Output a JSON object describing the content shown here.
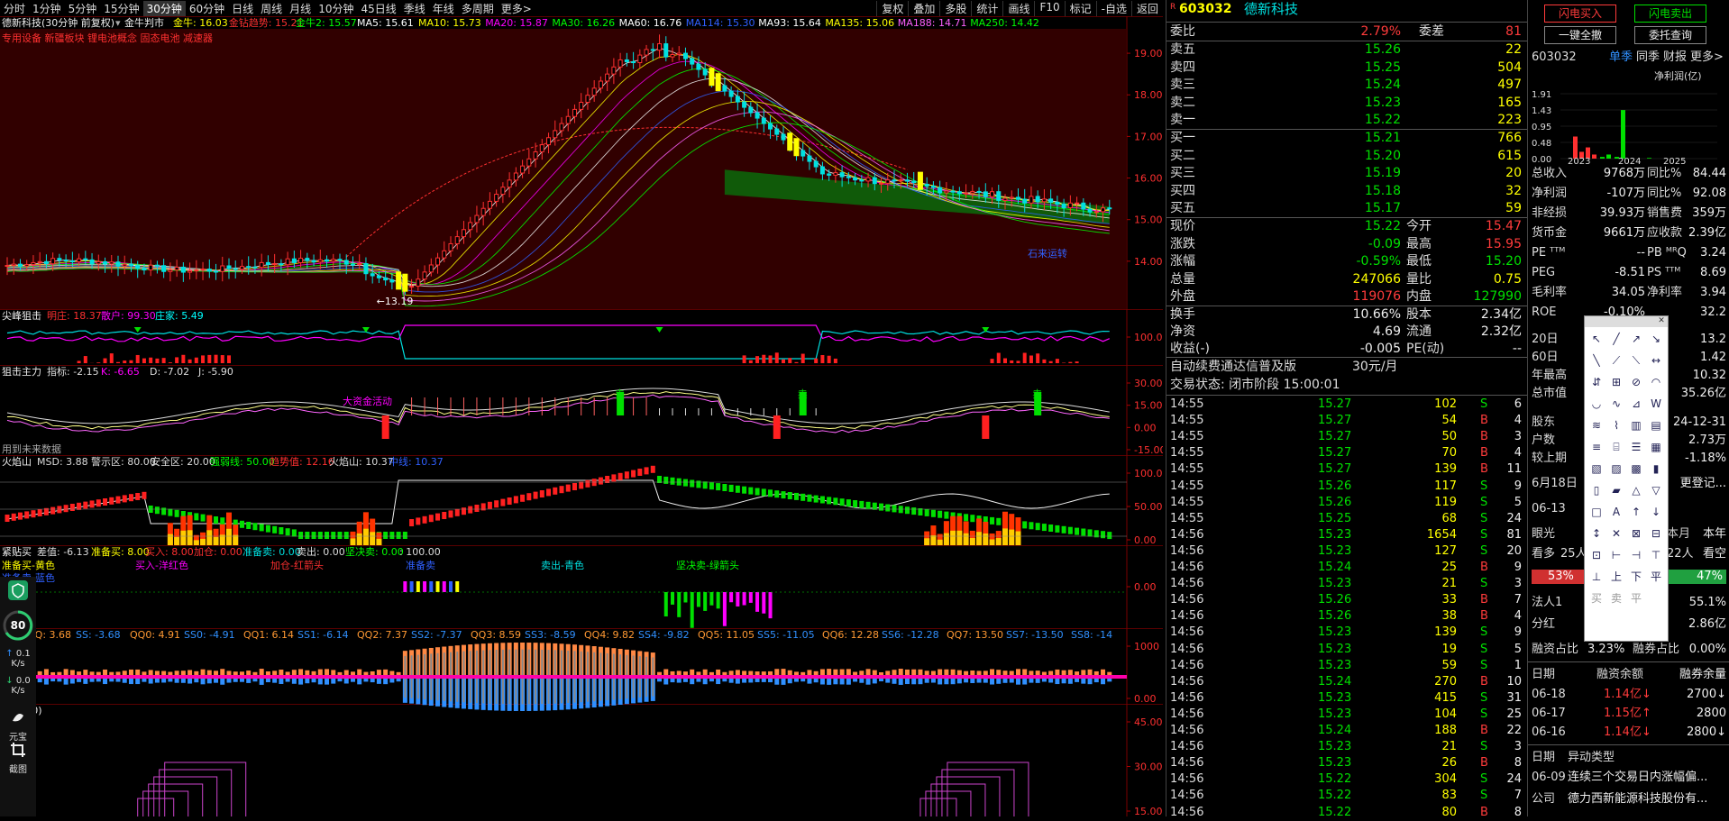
{
  "toolbar": {
    "periods": [
      "分时",
      "1分钟",
      "5分钟",
      "15分钟",
      "30分钟",
      "60分钟",
      "日线",
      "周线",
      "月线",
      "10分钟",
      "45日线",
      "季线",
      "年线",
      "多周期",
      "更多>"
    ],
    "active_period": 4,
    "tools": [
      "复权",
      "叠加",
      "多股",
      "统计",
      "画线",
      "F10",
      "标记",
      "-自选",
      "返回"
    ]
  },
  "main_panel": {
    "title": "德新科技(30分钟 前复权)",
    "indicator": "金牛判市",
    "values": [
      {
        "label": "金牛: 16.03",
        "color": "#ffff00"
      },
      {
        "label": "金钻趋势: 15.21",
        "color": "#ff3030"
      },
      {
        "label": "金牛2: 15.57",
        "color": "#00ff00"
      },
      {
        "label": "MA5: 15.61",
        "color": "#ffffff"
      },
      {
        "label": "MA10: 15.73",
        "color": "#ffff00"
      },
      {
        "label": "MA20: 15.87",
        "color": "#ff00ff"
      },
      {
        "label": "MA30: 16.26",
        "color": "#00ff00"
      },
      {
        "label": "MA60: 16.76",
        "color": "#ffffff"
      },
      {
        "label": "MA114: 15.30",
        "color": "#3060ff"
      },
      {
        "label": "MA93: 15.64",
        "color": "#ffffff"
      },
      {
        "label": "MA135: 15.06",
        "color": "#ffff00"
      },
      {
        "label": "MA188: 14.71",
        "color": "#ff60ff"
      },
      {
        "label": "MA250: 14.42",
        "color": "#00ff00"
      }
    ],
    "concepts": "专用设备 新疆板块 锂电池概念 固态电池 减速器",
    "low_label": "←13.19",
    "note": "石来运转",
    "yticks": [
      "19.00",
      "18.00",
      "17.00",
      "16.00",
      "15.00",
      "14.00"
    ]
  },
  "panels": [
    {
      "name": "尖峰狙击",
      "values": [
        {
          "label": "明庄: 18.37",
          "color": "#ff3030"
        },
        {
          "label": "散户: 99.30",
          "color": "#ff00ff"
        },
        {
          "label": "庄家: 5.49",
          "color": "#00ffff"
        }
      ],
      "yticks": [
        "100.0"
      ]
    },
    {
      "name": "狙击主力",
      "values": [
        {
          "label": "指标: -2.15",
          "color": "#dddddd"
        },
        {
          "label": "K: -6.65",
          "color": "#ff00ff"
        },
        {
          "label": "D: -7.02",
          "color": "#dddddd"
        },
        {
          "label": "J: -5.90",
          "color": "#dddddd"
        }
      ],
      "yticks": [
        "30.00",
        "15.00",
        "0.00",
        "-15.00"
      ],
      "note": "用到未来数据",
      "annot": "大资金活动",
      "sell": "卖"
    },
    {
      "name": "火焰山",
      "values": [
        {
          "label": "MSD: 3.88",
          "color": "#dddddd"
        },
        {
          "label": "警示区: 80.00",
          "color": "#dddddd"
        },
        {
          "label": "安全区: 20.00",
          "color": "#dddddd"
        },
        {
          "label": "强弱线: 50.00",
          "color": "#00ff00"
        },
        {
          "label": "趋势值: 12.16",
          "color": "#ff3030"
        },
        {
          "label": "火焰山: 10.37",
          "color": "#dddddd"
        },
        {
          "label": "中线: 10.37",
          "color": "#3060ff"
        }
      ],
      "yticks": [
        "100.0",
        "50.00",
        "0.00"
      ]
    },
    {
      "name": "紧贴买",
      "values": [
        {
          "label": "差值: -6.13",
          "color": "#dddddd"
        },
        {
          "label": "准备买: 8.00",
          "color": "#ffff00"
        },
        {
          "label": "买入: 8.00",
          "color": "#ff3030"
        },
        {
          "label": "加仓: 0.00",
          "color": "#ff3030"
        },
        {
          "label": "准备卖: 0.00",
          "color": "#00e0e0"
        },
        {
          "label": "卖出: 0.00",
          "color": "#dddddd"
        },
        {
          "label": "坚决卖: 0.00",
          "color": "#00ff00"
        },
        {
          "label": ": 100.00",
          "color": "#dddddd"
        }
      ],
      "legend": [
        {
          "t": "准备买-黄色",
          "c": "#ffff00"
        },
        {
          "t": "买入-洋红色",
          "c": "#ff00ff"
        },
        {
          "t": "加仓-红箭头",
          "c": "#ff3030"
        },
        {
          "t": "准备卖",
          "c": "#3060ff"
        },
        {
          "t": "卖出-青色",
          "c": "#00e0e0"
        },
        {
          "t": "坚决卖-绿箭头",
          "c": "#00ff00"
        }
      ],
      "sub": "准备卖-蓝色",
      "yticks": [
        "0.00"
      ]
    },
    {
      "name": "出击",
      "values": [
        {
          "label": "QQ: 3.68",
          "color": "#ff9933"
        },
        {
          "label": "SS: -3.68",
          "color": "#3090ff"
        },
        {
          "label": "QQ0: 4.91",
          "color": "#ff9933"
        },
        {
          "label": "SS0: -4.91",
          "color": "#3090ff"
        },
        {
          "label": "QQ1: 6.14",
          "color": "#ff9933"
        },
        {
          "label": "SS1: -6.14",
          "color": "#3090ff"
        },
        {
          "label": "QQ2: 7.37",
          "color": "#ff9933"
        },
        {
          "label": "SS2: -7.37",
          "color": "#3090ff"
        },
        {
          "label": "QQ3: 8.59",
          "color": "#ff9933"
        },
        {
          "label": "SS3: -8.59",
          "color": "#3090ff"
        },
        {
          "label": "QQ4: 9.82",
          "color": "#ff9933"
        },
        {
          "label": "SS4: -9.82",
          "color": "#3090ff"
        },
        {
          "label": "QQ5: 11.05",
          "color": "#ff9933"
        },
        {
          "label": "SS5: -11.05",
          "color": "#3090ff"
        },
        {
          "label": "QQ6: 12.28",
          "color": "#ff9933"
        },
        {
          "label": "SS6: -12.28",
          "color": "#3090ff"
        },
        {
          "label": "QQ7: 13.50",
          "color": "#ff9933"
        },
        {
          "label": "SS7: -13.50",
          "color": "#3090ff"
        },
        {
          "label": "SS8: -14",
          "color": "#3090ff"
        }
      ],
      "yticks": [
        "1000",
        "0.00"
      ]
    },
    {
      "name": "能量(50)",
      "values": [],
      "yticks": [
        "45.00",
        "30.00",
        "15.00"
      ]
    }
  ],
  "quote": {
    "code": "603032",
    "name": "德新科技",
    "weibi_label": "委比",
    "weibi": "2.79%",
    "weicha_label": "委差",
    "weicha": "81",
    "sells": [
      {
        "label": "卖五",
        "price": "15.26",
        "vol": "22"
      },
      {
        "label": "卖四",
        "price": "15.25",
        "vol": "504"
      },
      {
        "label": "卖三",
        "price": "15.24",
        "vol": "497"
      },
      {
        "label": "卖二",
        "price": "15.23",
        "vol": "165"
      },
      {
        "label": "卖一",
        "price": "15.22",
        "vol": "223"
      }
    ],
    "buys": [
      {
        "label": "买一",
        "price": "15.21",
        "vol": "766"
      },
      {
        "label": "买二",
        "price": "15.20",
        "vol": "615"
      },
      {
        "label": "买三",
        "price": "15.19",
        "vol": "20"
      },
      {
        "label": "买四",
        "price": "15.18",
        "vol": "32"
      },
      {
        "label": "买五",
        "price": "15.17",
        "vol": "59"
      }
    ],
    "stats": [
      {
        "k": "现价",
        "v": "15.22",
        "vc": "green",
        "k2": "今开",
        "v2": "15.47",
        "v2c": "red"
      },
      {
        "k": "涨跌",
        "v": "-0.09",
        "vc": "green",
        "k2": "最高",
        "v2": "15.95",
        "v2c": "red"
      },
      {
        "k": "涨幅",
        "v": "-0.59%",
        "vc": "green",
        "k2": "最低",
        "v2": "15.20",
        "v2c": "green"
      },
      {
        "k": "总量",
        "v": "247066",
        "vc": "yellow",
        "k2": "量比",
        "v2": "0.75",
        "v2c": "yellow"
      },
      {
        "k": "外盘",
        "v": "119076",
        "vc": "red",
        "k2": "内盘",
        "v2": "127990",
        "v2c": "green"
      }
    ],
    "stats2": [
      {
        "k": "换手",
        "v": "10.66%",
        "k2": "股本",
        "v2": "2.34亿"
      },
      {
        "k": "净资",
        "v": "4.69",
        "k2": "流通",
        "v2": "2.32亿"
      },
      {
        "k": "收益(-)",
        "v": "-0.005",
        "k2": "PE(动)",
        "v2": "--"
      }
    ],
    "promo_prefix": "自动续费通达信普及版",
    "promo_price": "30元/月",
    "status": "交易状态: 闭市阶段 15:00:01",
    "ticks": [
      {
        "t": "14:55",
        "p": "15.27",
        "v": "102",
        "s": "S",
        "n": "6"
      },
      {
        "t": "14:55",
        "p": "15.27",
        "v": "54",
        "s": "B",
        "n": "4"
      },
      {
        "t": "14:55",
        "p": "15.27",
        "v": "50",
        "s": "B",
        "n": "3"
      },
      {
        "t": "14:55",
        "p": "15.27",
        "v": "70",
        "s": "B",
        "n": "4"
      },
      {
        "t": "14:55",
        "p": "15.27",
        "v": "139",
        "s": "B",
        "n": "11"
      },
      {
        "t": "14:55",
        "p": "15.26",
        "v": "117",
        "s": "S",
        "n": "9"
      },
      {
        "t": "14:55",
        "p": "15.26",
        "v": "119",
        "s": "S",
        "n": "5"
      },
      {
        "t": "14:55",
        "p": "15.25",
        "v": "68",
        "s": "S",
        "n": "24"
      },
      {
        "t": "14:56",
        "p": "15.23",
        "v": "1654",
        "s": "S",
        "n": "81"
      },
      {
        "t": "14:56",
        "p": "15.23",
        "v": "127",
        "s": "S",
        "n": "20"
      },
      {
        "t": "14:56",
        "p": "15.24",
        "v": "25",
        "s": "B",
        "n": "9"
      },
      {
        "t": "14:56",
        "p": "15.23",
        "v": "21",
        "s": "S",
        "n": "3"
      },
      {
        "t": "14:56",
        "p": "15.26",
        "v": "33",
        "s": "B",
        "n": "7"
      },
      {
        "t": "14:56",
        "p": "15.26",
        "v": "38",
        "s": "B",
        "n": "4"
      },
      {
        "t": "14:56",
        "p": "15.23",
        "v": "139",
        "s": "S",
        "n": "9"
      },
      {
        "t": "14:56",
        "p": "15.23",
        "v": "19",
        "s": "S",
        "n": "5"
      },
      {
        "t": "14:56",
        "p": "15.23",
        "v": "59",
        "s": "S",
        "n": "1"
      },
      {
        "t": "14:56",
        "p": "15.24",
        "v": "270",
        "s": "B",
        "n": "10"
      },
      {
        "t": "14:56",
        "p": "15.23",
        "v": "415",
        "s": "S",
        "n": "31"
      },
      {
        "t": "14:56",
        "p": "15.23",
        "v": "104",
        "s": "S",
        "n": "25"
      },
      {
        "t": "14:56",
        "p": "15.24",
        "v": "188",
        "s": "B",
        "n": "22"
      },
      {
        "t": "14:56",
        "p": "15.23",
        "v": "21",
        "s": "S",
        "n": "3"
      },
      {
        "t": "14:56",
        "p": "15.23",
        "v": "26",
        "s": "B",
        "n": "8"
      },
      {
        "t": "14:56",
        "p": "15.22",
        "v": "304",
        "s": "S",
        "n": "24"
      },
      {
        "t": "14:56",
        "p": "15.22",
        "v": "83",
        "s": "S",
        "n": "7"
      },
      {
        "t": "14:56",
        "p": "15.22",
        "v": "80",
        "s": "B",
        "n": "8"
      }
    ]
  },
  "f10": {
    "buttons": [
      "闪电买入",
      "闪电卖出",
      "一键全撤",
      "委托查询"
    ],
    "code": "603032",
    "tabs": [
      "单季",
      "同季",
      "财报",
      "更多>"
    ],
    "chart_title": "净利润(亿)",
    "yticks": [
      "1.91",
      "1.43",
      "0.95",
      "0.48",
      "0.00"
    ],
    "xticks": [
      "2023",
      "2024",
      "2025"
    ],
    "rows": [
      {
        "k": "总收入",
        "a": "9768万",
        "b": "同比%",
        "c": "84.44"
      },
      {
        "k": "净利润",
        "a": "-107万",
        "b": "同比%",
        "c": "92.08"
      },
      {
        "k": "非经损",
        "a": "39.93万",
        "b": "销售费",
        "c": "359万"
      },
      {
        "k": "货币金",
        "a": "9661万",
        "b": "应收款",
        "c": "2.39亿"
      },
      {
        "k": "PE ᵀᵀᴹ",
        "a": "--",
        "b": "PB ᴹᴿQ",
        "c": "3.24"
      },
      {
        "k": "PEG",
        "a": "-8.51",
        "b": "PS ᵀᵀᴹ",
        "c": "8.69"
      },
      {
        "k": "毛利率",
        "a": "34.05",
        "b": "净利率",
        "c": "3.94"
      },
      {
        "k": "ROE",
        "a": "-0.10%",
        "b": "",
        "c": "32.2"
      }
    ],
    "rows2": [
      {
        "k": "20日",
        "c": "13.2"
      },
      {
        "k": "60日",
        "c": "1.42"
      },
      {
        "k": "年最高",
        "c": "10.32"
      },
      {
        "k": "总市值",
        "c": "35.26亿"
      }
    ],
    "rows3": [
      {
        "k": "股东",
        "c": "24-12-31"
      },
      {
        "k": "户数",
        "c": "2.73万"
      },
      {
        "k": "较上期",
        "c": "-1.18%"
      }
    ],
    "news_date": "6月18日",
    "more_login": "更登记...",
    "date2": "06-13",
    "half": [
      "本月",
      "本年"
    ],
    "view_label": "眼光",
    "bull_label": "看多",
    "bull_n": "25人",
    "bear_n": "22人",
    "bear_label": "看空",
    "bull_pct": "53%",
    "bear_pct": "47%",
    "holder_label": "法人1",
    "holder_val": "55.1%",
    "fenhong_label": "分红",
    "fenhong_val": "2.86亿",
    "margin_label": "融资占比",
    "margin_val": "3.23%",
    "margin2_label": "融券占比",
    "margin2_val": "0.00%",
    "margin_headers": [
      "日期",
      "融资余额",
      "融券余量"
    ],
    "margin_rows": [
      {
        "d": "06-18",
        "a": "1.14亿↓",
        "b": "2700↓"
      },
      {
        "d": "06-17",
        "a": "1.15亿↑",
        "b": "2800"
      },
      {
        "d": "06-16",
        "a": "1.14亿↓",
        "b": "2800↓"
      }
    ],
    "event_headers": [
      "日期",
      "异动类型"
    ],
    "event_date": "06-09",
    "event_text": "连续三个交易日内涨幅偏...",
    "company_label": "公司",
    "company": "德力西新能源科技股份有..."
  },
  "toolbox_icons": [
    "↖",
    "╱",
    "↗",
    "↘",
    "╲",
    "⟋",
    "⟍",
    "↔",
    "⇵",
    "⊞",
    "⊘",
    "◠",
    "◡",
    "∿",
    "⊿",
    "W",
    "≋",
    "⌇",
    "▥",
    "▤",
    "≡",
    "⌸",
    "☰",
    "▦",
    "▧",
    "▨",
    "▩",
    "▮",
    "▯",
    "▰",
    "△",
    "▽",
    "□",
    "A",
    "↑",
    "↓",
    "↕",
    "✕",
    "⊠",
    "⊟",
    "⊡",
    "⊢",
    "⊣",
    "⊤",
    "⊥",
    "上",
    "下",
    "平"
  ],
  "toolbox_labels": [
    "买",
    "卖",
    "平"
  ],
  "sidebar": {
    "score": "80",
    "up_rate": "0.1",
    "down_rate": "0.0",
    "unit": "K/s",
    "item1": "元宝",
    "item2": "截图"
  }
}
